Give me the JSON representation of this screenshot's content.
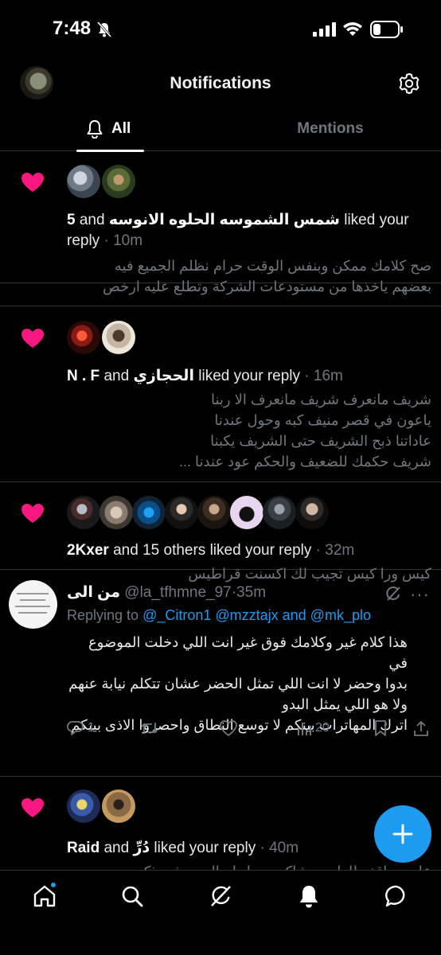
{
  "status_bar": {
    "time": "7:48"
  },
  "header": {
    "title": "Notifications"
  },
  "tabs": {
    "all": "All",
    "mentions": "Mentions"
  },
  "notifications": [
    {
      "name_primary": "5",
      "joiner": " and ",
      "name_secondary": "شمس الشموسه الحلوه الانوسه",
      "action": " liked your",
      "action_line2": "reply",
      "time": " · 10m",
      "excerpt": [
        "صح كلامك ممكن وبنفس الوقت حرام نظلم الجميع فيه",
        "بعضهم ياخذها من مستودعات الشركة وتطلع عليه ارخص"
      ]
    },
    {
      "name_primary": "N . F",
      "joiner": " and ",
      "name_secondary": "الحجازي",
      "action": " liked your reply",
      "time": " · 16m",
      "excerpt": [
        "شريف مانعرف شريف مانعرف الا ربنا",
        "ياعون في قصر منيف كبه وحول عندنا",
        "عاداتنا ذبح الشريف حتى الشريف يكبنا",
        "شريف حكمك للضعيف والحكم عود عندنا ..."
      ]
    },
    {
      "name_primary": "2Kxer",
      "action": " and 15 others liked your reply",
      "time": " · 32m",
      "excerpt": [
        "كيس ورا كيس تجيب لك اكسنت قراطيس"
      ]
    },
    {
      "name_primary": "Raid",
      "joiner": " and ",
      "name_secondary": "دُرِّ",
      "action": " liked your reply",
      "time": " · 40m",
      "excerpt": [
        "عليه مواقف للطيبين شاكرين ما دام المعروف يذكر"
      ]
    }
  ],
  "tweet": {
    "display_name": "من الى",
    "handle": "@la_tfhmne_97",
    "time": "·35m",
    "replying_prefix": "Replying to ",
    "replying_to": "@_Citron1 @mzztajx and @mk_plo",
    "body": [
      "هذا كلام غير وكلامك فوق غير انت اللي دخلت الموضوع في",
      "بدوا وحضر لا انت اللي تمثل الحضر عشان تتكلم نيابة عنهم",
      "ولا هو اللي يمثل البدو",
      "اترك المهاترات بينكم لا توسع النطاق واحصروا الاذى بينكم"
    ],
    "reply_count": "1",
    "views": "20"
  },
  "colors": {
    "accent": "#1d9bf0",
    "heart": "#f91880",
    "muted": "#71767b",
    "divider": "#2f3336"
  },
  "icons": [
    "bell-off-icon",
    "signal-icon",
    "wifi-icon",
    "battery-icon",
    "gear-icon",
    "bell-icon",
    "heart-icon",
    "grok-icon",
    "more-icon",
    "reply-icon",
    "retweet-icon",
    "like-icon",
    "views-icon",
    "bookmark-icon",
    "share-icon",
    "plus-icon",
    "home-icon",
    "search-icon",
    "notifications-icon",
    "messages-icon"
  ]
}
